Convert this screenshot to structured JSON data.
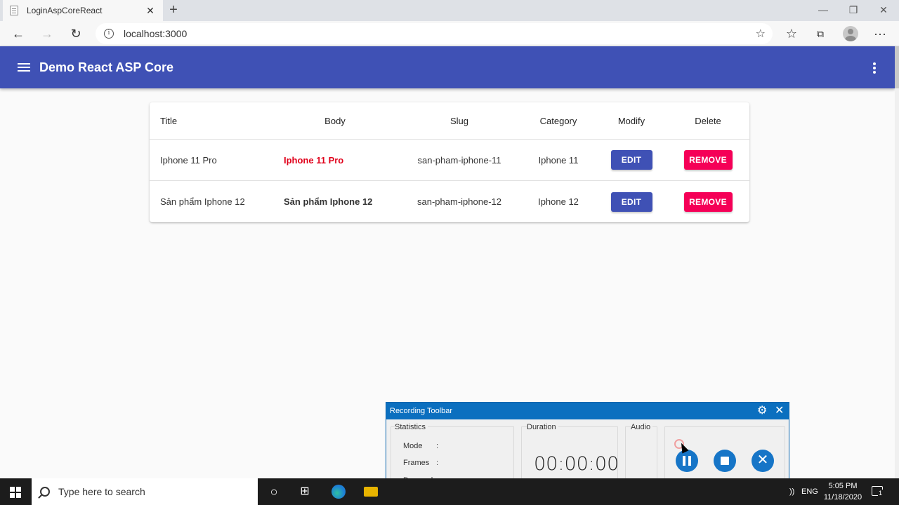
{
  "browser": {
    "tab_title": "LoginAspCoreReact",
    "tab_close": "✕",
    "new_tab": "+",
    "url": "localhost:3000",
    "info_glyph": "i",
    "back_glyph": "←",
    "forward_glyph": "→",
    "refresh_glyph": "↻",
    "star_glyph": "☆",
    "favorites_glyph": "☆",
    "collections_glyph": "⧉",
    "more_glyph": "···",
    "minimize_glyph": "—",
    "restore_glyph": "❐",
    "close_glyph": "✕"
  },
  "app": {
    "title": "Demo React ASP Core",
    "accent": "#3f51b5"
  },
  "table": {
    "headers": {
      "title": "Title",
      "body": "Body",
      "slug": "Slug",
      "category": "Category",
      "modify": "Modify",
      "delete": "Delete"
    },
    "rows": [
      {
        "title": "Iphone 11 Pro",
        "body": "Iphone 11 Pro",
        "slug": "san-pham-iphone-11",
        "category": "Iphone 11",
        "edit": "EDIT",
        "remove": "REMOVE"
      },
      {
        "title": "Sản phẩm Iphone 12",
        "body": "Sản phẩm Iphone 12",
        "slug": "san-pham-iphone-12",
        "category": "Iphone 12",
        "edit": "EDIT",
        "remove": "REMOVE"
      }
    ]
  },
  "recording": {
    "title": "Recording Toolbar",
    "gear_glyph": "⚙",
    "close_glyph": "✕",
    "statistics_label": "Statistics",
    "mode_label": "Mode",
    "frames_label": "Frames",
    "dropped_label": "Dropped",
    "colon": ":",
    "duration_label": "Duration",
    "duration_value": "00:00:00",
    "audio_label": "Audio",
    "speaker_glyph": "🔊",
    "cancel_glyph": "✕"
  },
  "taskbar": {
    "search_placeholder": "Type here to search",
    "task_view_glyph": "○",
    "snap_glyph": "⊞",
    "wifi_glyph": "))",
    "language": "ENG",
    "time": "5:05 PM",
    "date": "11/18/2020",
    "notification_count": "1"
  }
}
